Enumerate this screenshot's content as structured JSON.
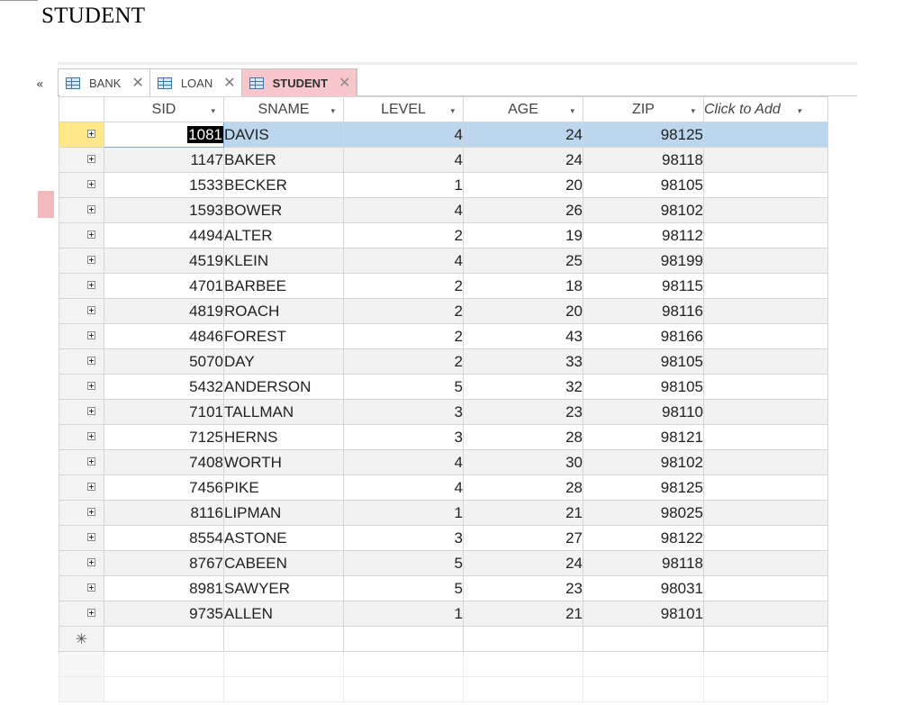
{
  "page_title": "STUDENT",
  "nav": {
    "collapse_glyph": "«"
  },
  "tabs": [
    {
      "label": "BANK",
      "icon": "table-icon",
      "close": "✕",
      "active": false
    },
    {
      "label": "LOAN",
      "icon": "table-icon",
      "close": "✕",
      "active": false
    },
    {
      "label": "STUDENT",
      "icon": "table-icon",
      "close": "✕",
      "active": true
    }
  ],
  "columns": {
    "sid": "SID",
    "sname": "SNAME",
    "level": "LEVEL",
    "age": "AGE",
    "zip": "ZIP",
    "add": "Click to Add",
    "dropdown_glyph": "▾"
  },
  "rows": [
    {
      "sid": "1081",
      "sname": "DAVIS",
      "level": "4",
      "age": "24",
      "zip": "98125"
    },
    {
      "sid": "1147",
      "sname": "BAKER",
      "level": "4",
      "age": "24",
      "zip": "98118"
    },
    {
      "sid": "1533",
      "sname": "BECKER",
      "level": "1",
      "age": "20",
      "zip": "98105"
    },
    {
      "sid": "1593",
      "sname": "BOWER",
      "level": "4",
      "age": "26",
      "zip": "98102"
    },
    {
      "sid": "4494",
      "sname": "ALTER",
      "level": "2",
      "age": "19",
      "zip": "98112"
    },
    {
      "sid": "4519",
      "sname": "KLEIN",
      "level": "4",
      "age": "25",
      "zip": "98199"
    },
    {
      "sid": "4701",
      "sname": "BARBEE",
      "level": "2",
      "age": "18",
      "zip": "98115"
    },
    {
      "sid": "4819",
      "sname": "ROACH",
      "level": "2",
      "age": "20",
      "zip": "98116"
    },
    {
      "sid": "4846",
      "sname": "FOREST",
      "level": "2",
      "age": "43",
      "zip": "98166"
    },
    {
      "sid": "5070",
      "sname": "DAY",
      "level": "2",
      "age": "33",
      "zip": "98105"
    },
    {
      "sid": "5432",
      "sname": "ANDERSON",
      "level": "5",
      "age": "32",
      "zip": "98105"
    },
    {
      "sid": "7101",
      "sname": "TALLMAN",
      "level": "3",
      "age": "23",
      "zip": "98110"
    },
    {
      "sid": "7125",
      "sname": "HERNS",
      "level": "3",
      "age": "28",
      "zip": "98121"
    },
    {
      "sid": "7408",
      "sname": "WORTH",
      "level": "4",
      "age": "30",
      "zip": "98102"
    },
    {
      "sid": "7456",
      "sname": "PIKE",
      "level": "4",
      "age": "28",
      "zip": "98125"
    },
    {
      "sid": "8116",
      "sname": "LIPMAN",
      "level": "1",
      "age": "21",
      "zip": "98025"
    },
    {
      "sid": "8554",
      "sname": "ASTONE",
      "level": "3",
      "age": "27",
      "zip": "98122"
    },
    {
      "sid": "8767",
      "sname": "CABEEN",
      "level": "5",
      "age": "24",
      "zip": "98118"
    },
    {
      "sid": "8981",
      "sname": "SAWYER",
      "level": "5",
      "age": "23",
      "zip": "98031"
    },
    {
      "sid": "9735",
      "sname": "ALLEN",
      "level": "1",
      "age": "21",
      "zip": "98101"
    }
  ],
  "new_record_glyph": "✳",
  "colors": {
    "active_tab": "#f7c7cb",
    "selected_row": "#bcd6ee",
    "sid_header": "#fff2a6"
  }
}
